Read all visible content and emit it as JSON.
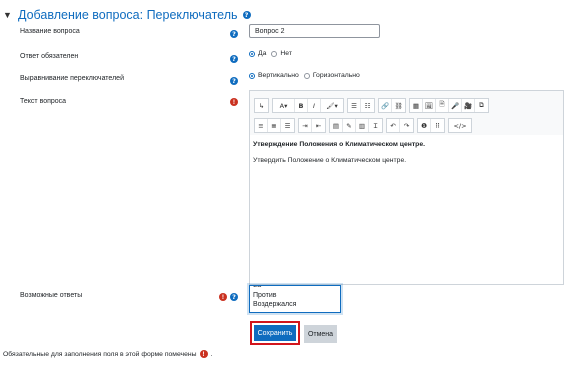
{
  "section": {
    "title": "Добавление вопроса: Переключатель",
    "help_symbol": "?"
  },
  "fields": {
    "name": {
      "label": "Название вопроса",
      "value": "Вопрос 2"
    },
    "required": {
      "label": "Ответ обязателен",
      "options": [
        "Да",
        "Нет"
      ],
      "selected": "Да"
    },
    "alignment": {
      "label": "Выравнивание переключателей",
      "options": [
        "Вертикально",
        "Горизонтально"
      ],
      "selected": "Вертикально"
    },
    "question_text": {
      "label": "Текст вопроса",
      "content_bold": "Утверждение Положения о Климатическом центре.",
      "content_text": "Утвердить Положение о Климатическом центре."
    },
    "answers": {
      "label": "Возможные ответы",
      "lines": [
        "За",
        "Против",
        "Воздержался"
      ]
    }
  },
  "toolbar": {
    "row1": [
      "↳",
      "A▾",
      "B",
      "I",
      "🖌▾",
      "☰",
      "☷",
      "🔗",
      "⛓",
      "▦",
      "🖼",
      "🗎",
      "🎤",
      "🎥",
      "⧉"
    ],
    "row2": [
      "≡",
      "≣",
      "☰",
      "⇥",
      "⇤",
      "▤",
      "✎",
      "▥",
      "Ɪ",
      "↶",
      "↷",
      "❶",
      "⠿",
      "</>"
    ]
  },
  "buttons": {
    "save": "Сохранить",
    "cancel": "Отмена"
  },
  "footer": {
    "note": "Обязательные для заполнения поля в этой форме помечены",
    "after": "."
  },
  "colors": {
    "accent": "#0f6cbf",
    "required": "#ca3120",
    "highlight": "#d2151c"
  }
}
